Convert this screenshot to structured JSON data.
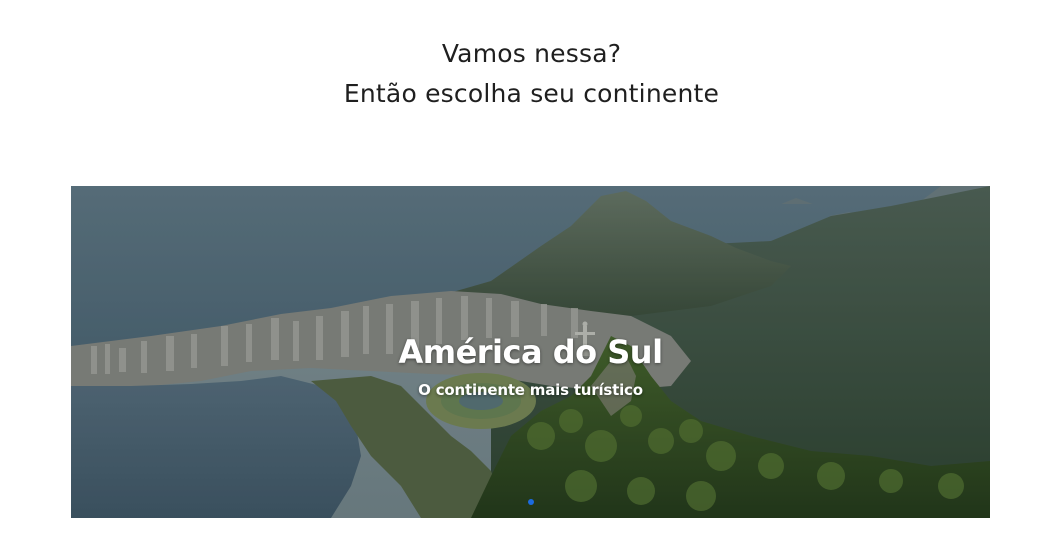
{
  "heading": {
    "line1": "Vamos nessa?",
    "line2": "Então escolha seu continente"
  },
  "carousel": {
    "active_slide": 1,
    "slides": [
      {
        "title": "América do Sul",
        "subtitle": "O continente mais turístico",
        "image_subject": "rio-de-janeiro-aerial"
      }
    ],
    "indicator_color": "#1c6be0"
  }
}
